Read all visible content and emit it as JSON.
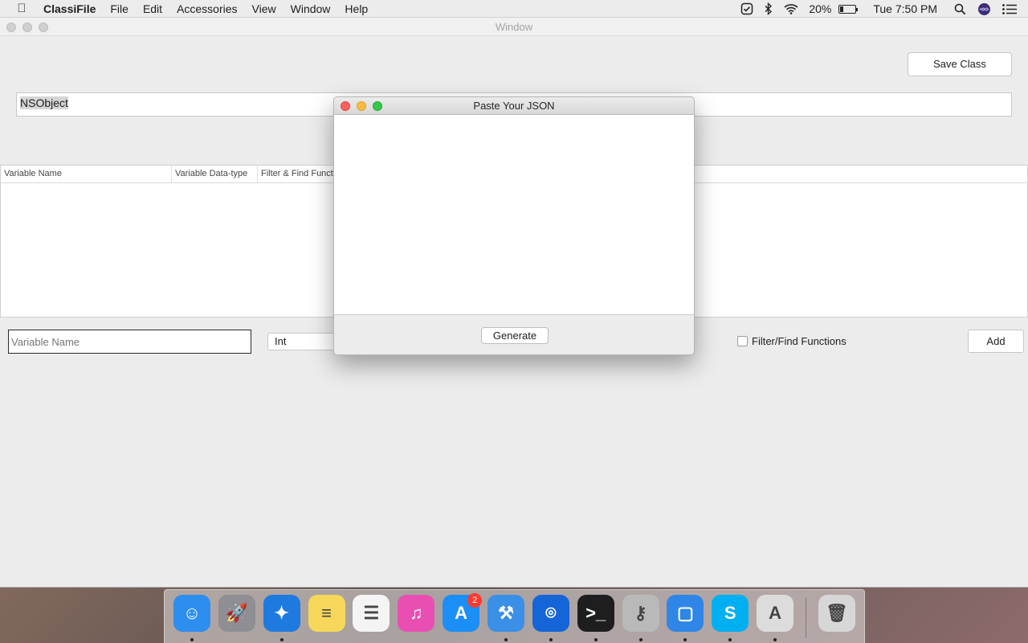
{
  "menubar": {
    "app_name": "ClassiFile",
    "items": [
      "File",
      "Edit",
      "Accessories",
      "View",
      "Window",
      "Help"
    ],
    "battery_percent": "20%",
    "battery_level": 0.2,
    "clock": "Tue 7:50 PM"
  },
  "window": {
    "title": "Window",
    "save_class_label": "Save Class",
    "class_name_value": "NSObject",
    "table_headers": [
      "Variable Name",
      "Variable Data-type",
      "Filter & Find Functions"
    ],
    "variable_name_placeholder": "Variable Name",
    "type_selected": "Int",
    "filter_checkbox_label": "Filter/Find Functions",
    "add_label": "Add"
  },
  "modal": {
    "title": "Paste Your JSON",
    "generate_label": "Generate"
  },
  "dock": {
    "apps": [
      {
        "name": "finder",
        "color": "#2d8ef0",
        "glyph": "☺",
        "running": true
      },
      {
        "name": "launchpad",
        "color": "#8e8e93",
        "glyph": "🚀",
        "running": false
      },
      {
        "name": "safari",
        "color": "#1f7ae0",
        "glyph": "✦",
        "running": true
      },
      {
        "name": "notes",
        "color": "#f6d75a",
        "glyph": "≡",
        "running": false
      },
      {
        "name": "reminders",
        "color": "#f4f4f4",
        "glyph": "☰",
        "running": false
      },
      {
        "name": "itunes",
        "color": "#e94fb2",
        "glyph": "♫",
        "running": false
      },
      {
        "name": "app-store",
        "color": "#1b8ff5",
        "glyph": "A",
        "running": false,
        "badge": "2"
      },
      {
        "name": "xcode",
        "color": "#3a8fe6",
        "glyph": "⚒",
        "running": true
      },
      {
        "name": "sourcetree",
        "color": "#1565d8",
        "glyph": "⌾",
        "running": true
      },
      {
        "name": "terminal",
        "color": "#1e1e1e",
        "glyph": ">_",
        "running": true
      },
      {
        "name": "keychain",
        "color": "#b9b9b9",
        "glyph": "⚷",
        "running": true
      },
      {
        "name": "simulator",
        "color": "#2f86e6",
        "glyph": "▢",
        "running": true
      },
      {
        "name": "skype",
        "color": "#00aff0",
        "glyph": "S",
        "running": true
      },
      {
        "name": "instruments",
        "color": "#dcdcdc",
        "glyph": "A",
        "running": true
      }
    ],
    "trash": {
      "name": "trash",
      "color": "#d7d7d7",
      "glyph": "🗑"
    }
  }
}
